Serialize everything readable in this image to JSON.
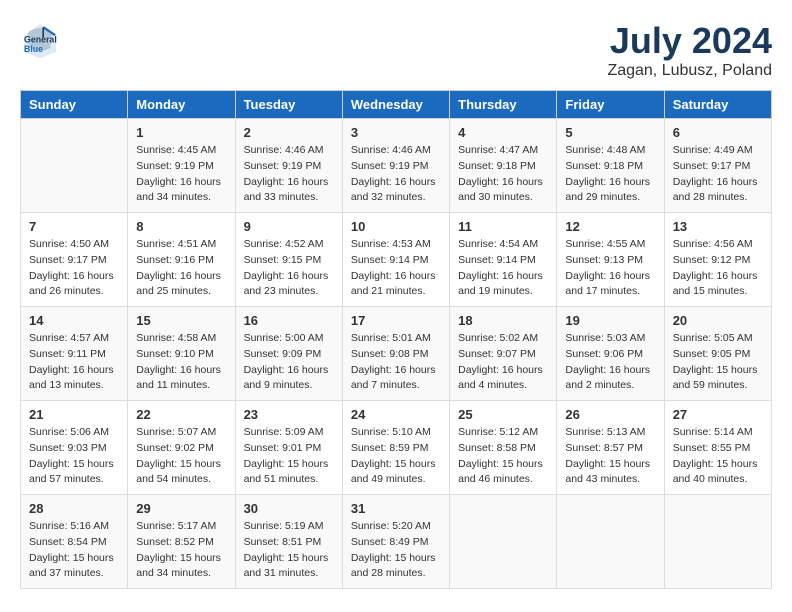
{
  "header": {
    "logo_line1": "General",
    "logo_line2": "Blue",
    "month": "July 2024",
    "location": "Zagan, Lubusz, Poland"
  },
  "weekdays": [
    "Sunday",
    "Monday",
    "Tuesday",
    "Wednesday",
    "Thursday",
    "Friday",
    "Saturday"
  ],
  "weeks": [
    [
      {
        "day": "",
        "sunrise": "",
        "sunset": "",
        "daylight": ""
      },
      {
        "day": "1",
        "sunrise": "Sunrise: 4:45 AM",
        "sunset": "Sunset: 9:19 PM",
        "daylight": "Daylight: 16 hours and 34 minutes."
      },
      {
        "day": "2",
        "sunrise": "Sunrise: 4:46 AM",
        "sunset": "Sunset: 9:19 PM",
        "daylight": "Daylight: 16 hours and 33 minutes."
      },
      {
        "day": "3",
        "sunrise": "Sunrise: 4:46 AM",
        "sunset": "Sunset: 9:19 PM",
        "daylight": "Daylight: 16 hours and 32 minutes."
      },
      {
        "day": "4",
        "sunrise": "Sunrise: 4:47 AM",
        "sunset": "Sunset: 9:18 PM",
        "daylight": "Daylight: 16 hours and 30 minutes."
      },
      {
        "day": "5",
        "sunrise": "Sunrise: 4:48 AM",
        "sunset": "Sunset: 9:18 PM",
        "daylight": "Daylight: 16 hours and 29 minutes."
      },
      {
        "day": "6",
        "sunrise": "Sunrise: 4:49 AM",
        "sunset": "Sunset: 9:17 PM",
        "daylight": "Daylight: 16 hours and 28 minutes."
      }
    ],
    [
      {
        "day": "7",
        "sunrise": "Sunrise: 4:50 AM",
        "sunset": "Sunset: 9:17 PM",
        "daylight": "Daylight: 16 hours and 26 minutes."
      },
      {
        "day": "8",
        "sunrise": "Sunrise: 4:51 AM",
        "sunset": "Sunset: 9:16 PM",
        "daylight": "Daylight: 16 hours and 25 minutes."
      },
      {
        "day": "9",
        "sunrise": "Sunrise: 4:52 AM",
        "sunset": "Sunset: 9:15 PM",
        "daylight": "Daylight: 16 hours and 23 minutes."
      },
      {
        "day": "10",
        "sunrise": "Sunrise: 4:53 AM",
        "sunset": "Sunset: 9:14 PM",
        "daylight": "Daylight: 16 hours and 21 minutes."
      },
      {
        "day": "11",
        "sunrise": "Sunrise: 4:54 AM",
        "sunset": "Sunset: 9:14 PM",
        "daylight": "Daylight: 16 hours and 19 minutes."
      },
      {
        "day": "12",
        "sunrise": "Sunrise: 4:55 AM",
        "sunset": "Sunset: 9:13 PM",
        "daylight": "Daylight: 16 hours and 17 minutes."
      },
      {
        "day": "13",
        "sunrise": "Sunrise: 4:56 AM",
        "sunset": "Sunset: 9:12 PM",
        "daylight": "Daylight: 16 hours and 15 minutes."
      }
    ],
    [
      {
        "day": "14",
        "sunrise": "Sunrise: 4:57 AM",
        "sunset": "Sunset: 9:11 PM",
        "daylight": "Daylight: 16 hours and 13 minutes."
      },
      {
        "day": "15",
        "sunrise": "Sunrise: 4:58 AM",
        "sunset": "Sunset: 9:10 PM",
        "daylight": "Daylight: 16 hours and 11 minutes."
      },
      {
        "day": "16",
        "sunrise": "Sunrise: 5:00 AM",
        "sunset": "Sunset: 9:09 PM",
        "daylight": "Daylight: 16 hours and 9 minutes."
      },
      {
        "day": "17",
        "sunrise": "Sunrise: 5:01 AM",
        "sunset": "Sunset: 9:08 PM",
        "daylight": "Daylight: 16 hours and 7 minutes."
      },
      {
        "day": "18",
        "sunrise": "Sunrise: 5:02 AM",
        "sunset": "Sunset: 9:07 PM",
        "daylight": "Daylight: 16 hours and 4 minutes."
      },
      {
        "day": "19",
        "sunrise": "Sunrise: 5:03 AM",
        "sunset": "Sunset: 9:06 PM",
        "daylight": "Daylight: 16 hours and 2 minutes."
      },
      {
        "day": "20",
        "sunrise": "Sunrise: 5:05 AM",
        "sunset": "Sunset: 9:05 PM",
        "daylight": "Daylight: 15 hours and 59 minutes."
      }
    ],
    [
      {
        "day": "21",
        "sunrise": "Sunrise: 5:06 AM",
        "sunset": "Sunset: 9:03 PM",
        "daylight": "Daylight: 15 hours and 57 minutes."
      },
      {
        "day": "22",
        "sunrise": "Sunrise: 5:07 AM",
        "sunset": "Sunset: 9:02 PM",
        "daylight": "Daylight: 15 hours and 54 minutes."
      },
      {
        "day": "23",
        "sunrise": "Sunrise: 5:09 AM",
        "sunset": "Sunset: 9:01 PM",
        "daylight": "Daylight: 15 hours and 51 minutes."
      },
      {
        "day": "24",
        "sunrise": "Sunrise: 5:10 AM",
        "sunset": "Sunset: 8:59 PM",
        "daylight": "Daylight: 15 hours and 49 minutes."
      },
      {
        "day": "25",
        "sunrise": "Sunrise: 5:12 AM",
        "sunset": "Sunset: 8:58 PM",
        "daylight": "Daylight: 15 hours and 46 minutes."
      },
      {
        "day": "26",
        "sunrise": "Sunrise: 5:13 AM",
        "sunset": "Sunset: 8:57 PM",
        "daylight": "Daylight: 15 hours and 43 minutes."
      },
      {
        "day": "27",
        "sunrise": "Sunrise: 5:14 AM",
        "sunset": "Sunset: 8:55 PM",
        "daylight": "Daylight: 15 hours and 40 minutes."
      }
    ],
    [
      {
        "day": "28",
        "sunrise": "Sunrise: 5:16 AM",
        "sunset": "Sunset: 8:54 PM",
        "daylight": "Daylight: 15 hours and 37 minutes."
      },
      {
        "day": "29",
        "sunrise": "Sunrise: 5:17 AM",
        "sunset": "Sunset: 8:52 PM",
        "daylight": "Daylight: 15 hours and 34 minutes."
      },
      {
        "day": "30",
        "sunrise": "Sunrise: 5:19 AM",
        "sunset": "Sunset: 8:51 PM",
        "daylight": "Daylight: 15 hours and 31 minutes."
      },
      {
        "day": "31",
        "sunrise": "Sunrise: 5:20 AM",
        "sunset": "Sunset: 8:49 PM",
        "daylight": "Daylight: 15 hours and 28 minutes."
      },
      {
        "day": "",
        "sunrise": "",
        "sunset": "",
        "daylight": ""
      },
      {
        "day": "",
        "sunrise": "",
        "sunset": "",
        "daylight": ""
      },
      {
        "day": "",
        "sunrise": "",
        "sunset": "",
        "daylight": ""
      }
    ]
  ]
}
